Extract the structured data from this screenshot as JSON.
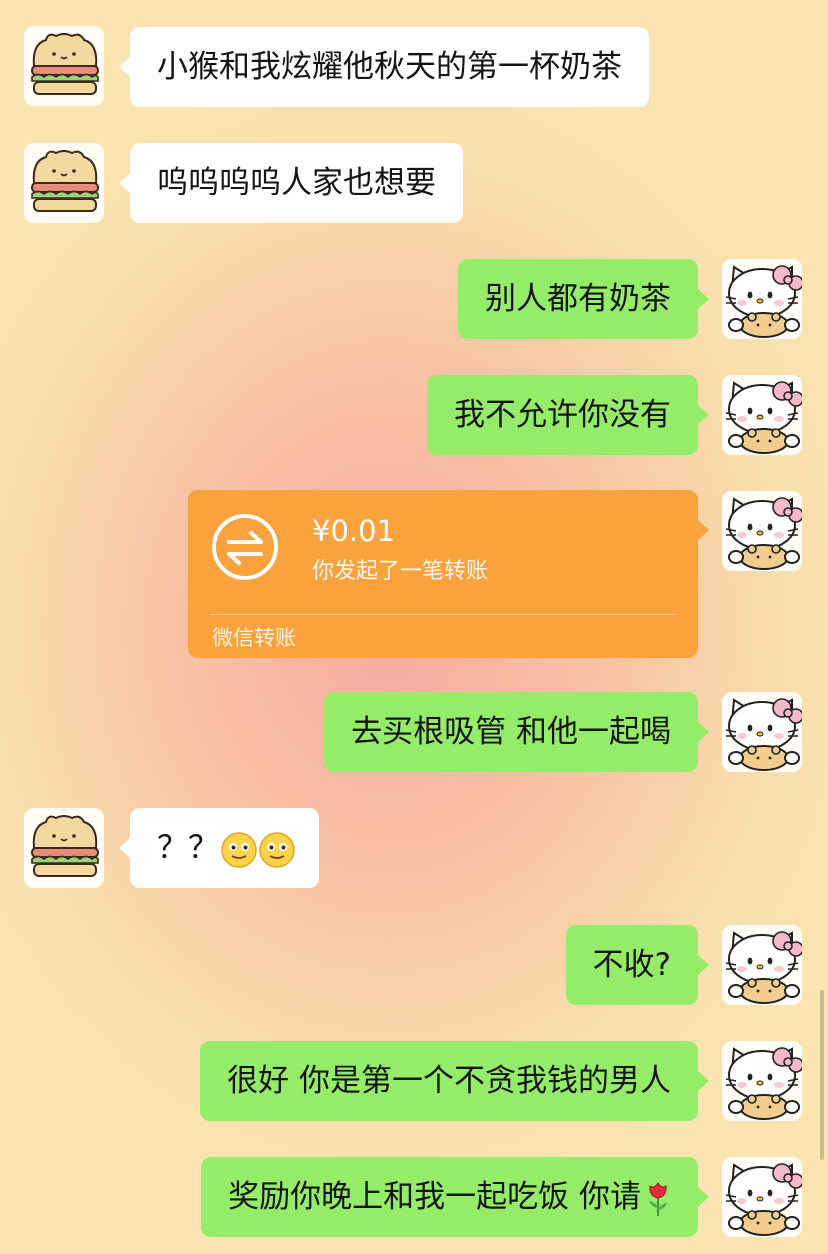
{
  "messages": [
    {
      "side": "in",
      "text": "小猴和我炫耀他秋天的第一杯奶茶"
    },
    {
      "side": "in",
      "text": "呜呜呜呜人家也想要"
    },
    {
      "side": "out",
      "text": "别人都有奶茶"
    },
    {
      "side": "out",
      "text": "我不允许你没有"
    },
    {
      "side": "out",
      "type": "transfer",
      "amount": "¥0.01",
      "desc": "你发起了一笔转账",
      "footer": "微信转账"
    },
    {
      "side": "out",
      "text": "去买根吸管 和他一起喝"
    },
    {
      "side": "in",
      "text": "？？",
      "emojis": [
        "smile-emoji",
        "smile-emoji"
      ]
    },
    {
      "side": "out",
      "text": "不收?"
    },
    {
      "side": "out",
      "text": "很好 你是第一个不贪我钱的男人"
    },
    {
      "side": "out",
      "text": "奖励你晚上和我一起吃饭 你请",
      "emojis": [
        "rose-emoji"
      ]
    }
  ],
  "colors": {
    "outgoing_bubble": "#95ec69",
    "incoming_bubble": "#ffffff",
    "transfer_card": "#f9a23e"
  },
  "avatars": {
    "incoming": "sandwich-bear-avatar",
    "outgoing": "hello-kitty-avatar"
  }
}
